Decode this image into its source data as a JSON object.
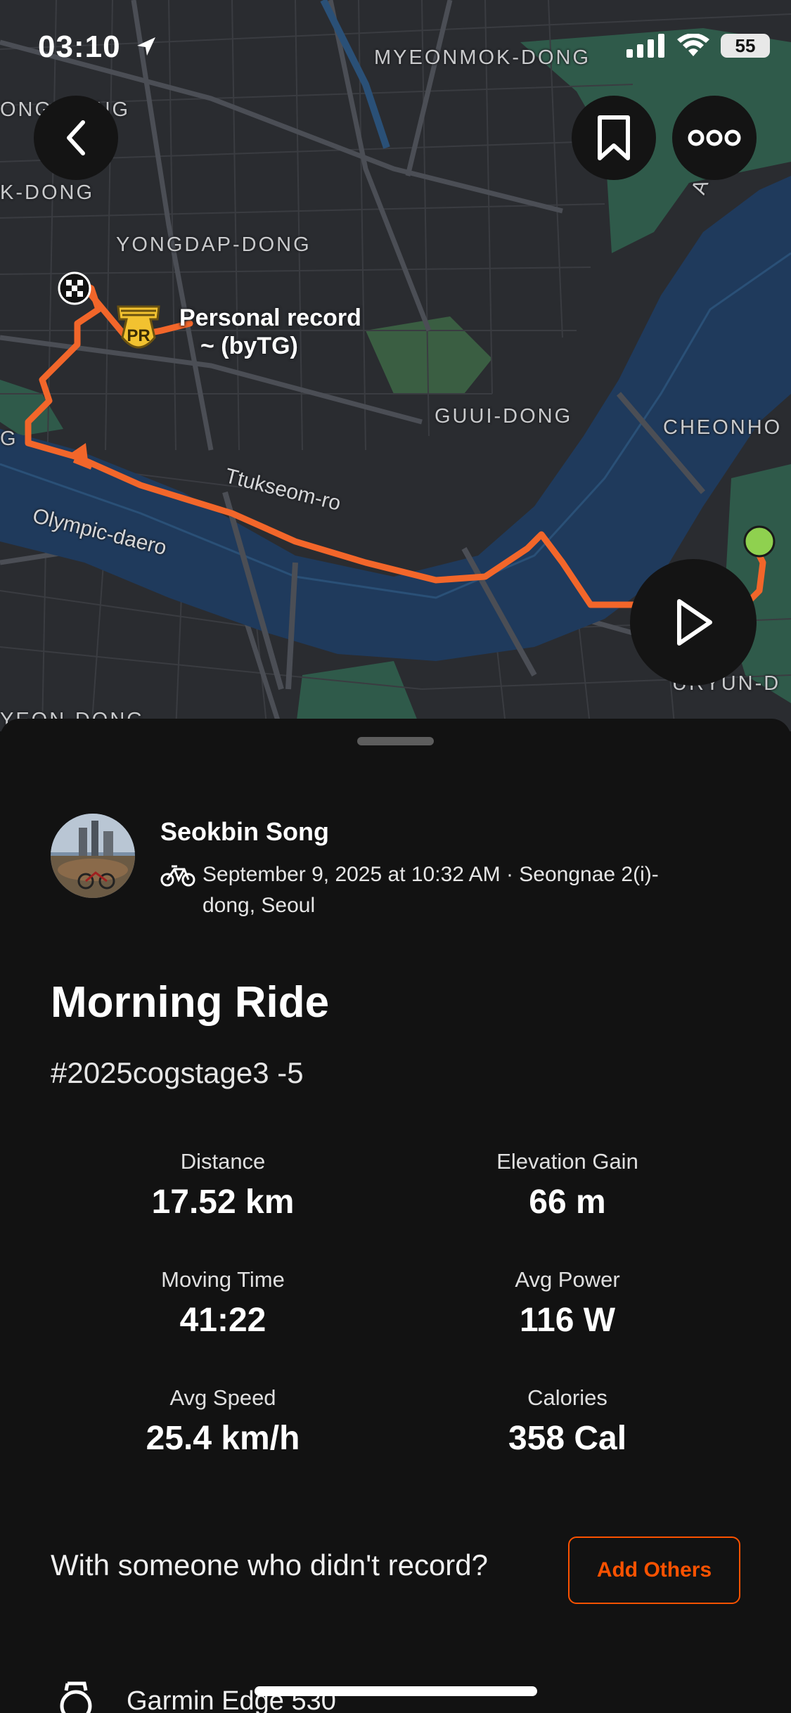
{
  "status_bar": {
    "time": "03:10",
    "battery": "55"
  },
  "map": {
    "labels": {
      "myeonmok": "MYEONMOK-DONG",
      "ong_dong": "ONG  DONG",
      "k_dong": "K-DONG",
      "yongdap": "YONGDAP-DONG",
      "guui": "GUUI-DONG",
      "cheonho": "CHEONHO",
      "guryun": "URYUN-D",
      "yeon_dong": "YEON-DONG",
      "g": "G",
      "ac": "Ac"
    },
    "roads": {
      "ttukseom": "Ttukseom-ro",
      "olympic": "Olympic-daero"
    },
    "pr_label_line1": "Personal record",
    "pr_label_line2": "~   (byTG)",
    "pr_badge": "PR"
  },
  "activity": {
    "athlete": "Seokbin Song",
    "meta": "September 9, 2025 at 10:32 AM · Seongnae 2(i)-dong, Seoul",
    "title": "Morning Ride",
    "description": "#2025cogstage3 -5",
    "stats": [
      {
        "label": "Distance",
        "value": "17.52 km"
      },
      {
        "label": "Elevation Gain",
        "value": "66 m"
      },
      {
        "label": "Moving Time",
        "value": "41:22"
      },
      {
        "label": "Avg Power",
        "value": "116 W"
      },
      {
        "label": "Avg Speed",
        "value": "25.4 km/h"
      },
      {
        "label": "Calories",
        "value": "358 Cal"
      }
    ],
    "with_others_text": "With someone who didn't record?",
    "add_others_label": "Add Others",
    "device": "Garmin Edge 530"
  },
  "colors": {
    "accent": "#fc5200",
    "route": "#f2662a",
    "water": "#1f3a5c",
    "park": "#2f5a4a",
    "start": "#8fd14f"
  }
}
